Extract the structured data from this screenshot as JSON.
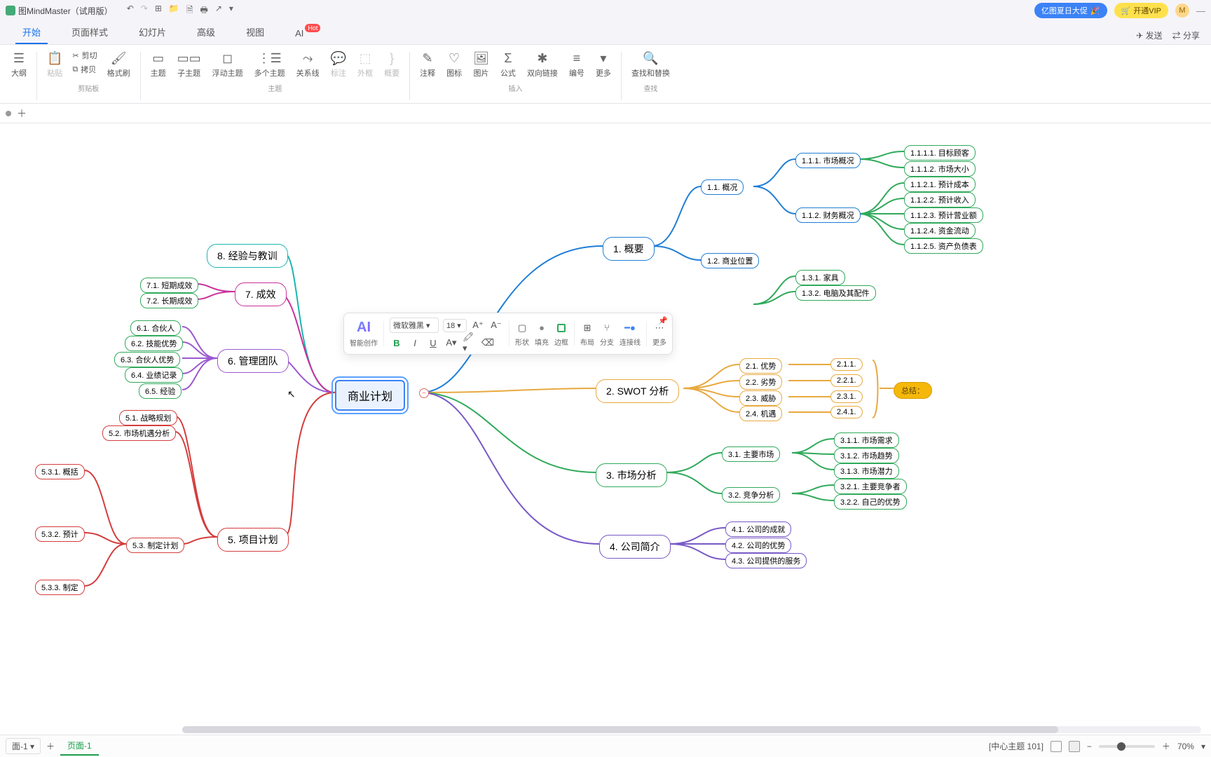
{
  "app": {
    "title": "图MindMaster（试用版）",
    "avatar": "M"
  },
  "promos": {
    "summer": "亿图夏日大促",
    "vip": "开通VIP"
  },
  "tabs": [
    "开始",
    "页面样式",
    "幻灯片",
    "高级",
    "视图",
    "AI"
  ],
  "tab_hot": "Hot",
  "tab_actions": {
    "send": "发送",
    "share": "分享"
  },
  "ribbon": {
    "outline": "大纲",
    "paste": "粘贴",
    "cut": "剪切",
    "copy": "拷贝",
    "format": "格式刷",
    "g_clipboard": "剪贴板",
    "topic": "主题",
    "subtopic": "子主题",
    "float": "浮动主题",
    "multi": "多个主题",
    "rel": "关系线",
    "callout": "标注",
    "boundary": "外框",
    "summary": "概要",
    "g_topic": "主题",
    "note": "注释",
    "icon": "图标",
    "image": "图片",
    "formula": "公式",
    "bilink": "双向链接",
    "number": "编号",
    "more": "更多",
    "g_insert": "插入",
    "findrep": "查找和替换",
    "g_find": "查找"
  },
  "float_tb": {
    "ai_label": "智能创作",
    "font": "微软雅黑",
    "size": "18",
    "shape": "形状",
    "fill": "填充",
    "border": "边框",
    "layout": "布局",
    "branch": "分支",
    "connector": "连接线",
    "more": "更多"
  },
  "mindmap": {
    "center": "商业计划",
    "n1": "1. 概要",
    "n11": "1.1. 概况",
    "n12": "1.2. 商业位置",
    "n111": "1.1.1. 市场概况",
    "n112": "1.1.2. 财务概况",
    "n1111": "1.1.1.1. 目标顾客",
    "n1112": "1.1.1.2. 市场大小",
    "n1121": "1.1.2.1. 预计成本",
    "n1122": "1.1.2.2. 预计收入",
    "n1123": "1.1.2.3. 预计营业额",
    "n1124": "1.1.2.4. 资金流动",
    "n1125": "1.1.2.5. 资产负债表",
    "n131": "1.3.1. 家具",
    "n132": "1.3.2. 电脑及其配件",
    "n2": "2. SWOT 分析",
    "n21": "2.1. 优势",
    "n22": "2.2. 劣势",
    "n23": "2.3. 威胁",
    "n24": "2.4. 机遇",
    "n211": "2.1.1.",
    "n221": "2.2.1.",
    "n231": "2.3.1.",
    "n241": "2.4.1.",
    "n2sum": "总结：",
    "n3": "3. 市场分析",
    "n31": "3.1. 主要市场",
    "n32": "3.2. 竞争分析",
    "n311": "3.1.1. 市场需求",
    "n312": "3.1.2. 市场趋势",
    "n313": "3.1.3. 市场潜力",
    "n321": "3.2.1. 主要竞争者",
    "n322": "3.2.2. 自己的优势",
    "n4": "4. 公司简介",
    "n41": "4.1. 公司的成就",
    "n42": "4.2. 公司的优势",
    "n43": "4.3. 公司提供的服务",
    "n5": "5. 项目计划",
    "n51": "5.1. 战略规划",
    "n52": "5.2. 市场机遇分析",
    "n53": "5.3. 制定计划",
    "n531": "5.3.1. 概括",
    "n532": "5.3.2. 预计",
    "n533": "5.3.3. 制定",
    "n6": "6. 管理团队",
    "n61": "6.1. 合伙人",
    "n62": "6.2. 技能优势",
    "n63": "6.3. 合伙人优势",
    "n64": "6.4. 业绩记录",
    "n65": "6.5. 经验",
    "n7": "7. 成效",
    "n71": "7.1. 短期成效",
    "n72": "7.2. 长期成效",
    "n8": "8. 经验与教训"
  },
  "footer": {
    "page_selector": "面-1",
    "page": "页面-1",
    "status": "[中心主题 101]",
    "zoom": "70%"
  }
}
